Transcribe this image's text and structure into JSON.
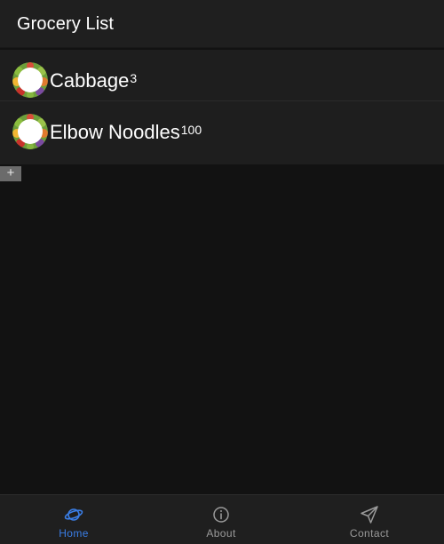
{
  "header": {
    "title": "Grocery List"
  },
  "items": [
    {
      "name": "Cabbage",
      "quantity": "3"
    },
    {
      "name": "Elbow Noodles",
      "quantity": "100"
    }
  ],
  "add_button": {
    "label": "+"
  },
  "tabs": [
    {
      "label": "Home",
      "icon": "planet-icon",
      "active": true
    },
    {
      "label": "About",
      "icon": "info-icon",
      "active": false
    },
    {
      "label": "Contact",
      "icon": "send-icon",
      "active": false
    }
  ],
  "colors": {
    "accent": "#3a7ee6",
    "background": "#121212",
    "surface": "#1f1f1f",
    "inactive_tab": "#9a9a9a"
  }
}
